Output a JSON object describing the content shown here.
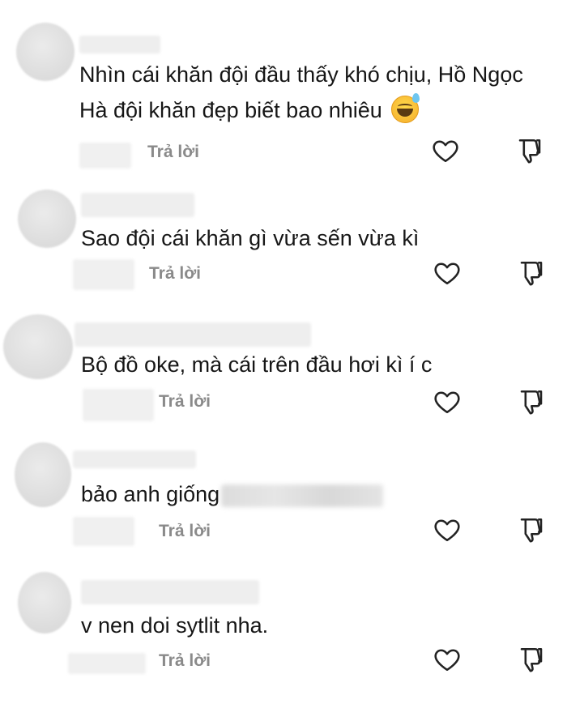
{
  "comments": [
    {
      "text_line1": "Nhìn cái khăn đội đầu thấy khó chịu, Hồ Ngọc",
      "text_line2": "Hà đội khăn đẹp biết bao nhiêu",
      "emoji": "grinning-sweat-emoji",
      "reply_label": "Trả lời"
    },
    {
      "text_line1": "Sao đội cái khăn gì vừa sến vừa kì",
      "reply_label": "Trả lời"
    },
    {
      "text_line1": "Bộ đồ oke, mà cái trên đầu hơi kì í c",
      "reply_label": "Trả lời"
    },
    {
      "text_line1": "bảo anh giống",
      "redacted": true,
      "reply_label": "Trả lời"
    },
    {
      "text_line1": "v nen doi sytlit nha.",
      "reply_label": "Trả lời"
    }
  ],
  "icons": {
    "like": "heart-outline-icon",
    "dislike": "thumbs-down-icon"
  },
  "colors": {
    "text": "#161616",
    "meta": "#8a8a8a",
    "background": "#ffffff"
  }
}
